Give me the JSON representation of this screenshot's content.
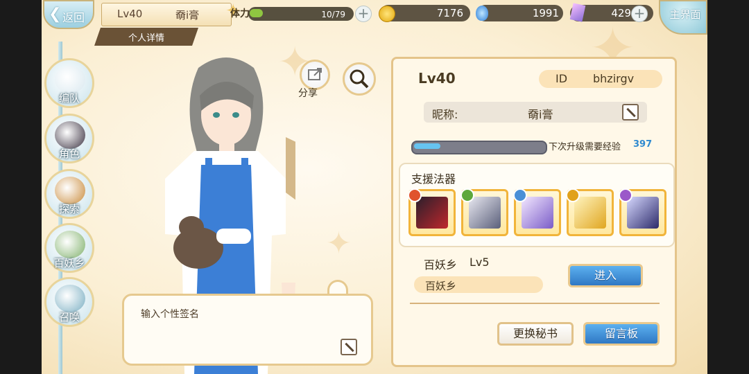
{
  "top_bar": {
    "back_label": "返回",
    "player_level": "Lv40",
    "player_name": "奣i膏",
    "subtab_label": "个人详情",
    "stamina_label": "体力",
    "stamina_text": "10/79",
    "stamina_fraction": 0.13,
    "coins": "7176",
    "spirit": "1991",
    "crystals": "429",
    "home_label": "主界面"
  },
  "side_menu": {
    "items": [
      {
        "label": "编队",
        "icon": "team-icon"
      },
      {
        "label": "角色",
        "icon": "character-icon"
      },
      {
        "label": "探索",
        "icon": "explore-icon"
      },
      {
        "label": "百妖乡",
        "icon": "village-icon"
      },
      {
        "label": "召唤",
        "icon": "summon-icon"
      }
    ]
  },
  "actions": {
    "share_label": "分享"
  },
  "signature": {
    "placeholder": "输入个性签名"
  },
  "profile": {
    "level": "Lv40",
    "id_label": "ID",
    "id_value": "bhzirgv",
    "nickname_label": "昵称:",
    "nickname_value": "奣i膏",
    "xp_label": "下次升级需要经验",
    "xp_value": "397",
    "xp_fraction": 0.2,
    "support_title": "支援法器",
    "weapons": [
      {
        "icon": "red-fan-weapon-icon",
        "element_color": "#e0532d"
      },
      {
        "icon": "crossbow-weapon-icon",
        "element_color": "#5ea83c"
      },
      {
        "icon": "purple-sword-weapon-icon",
        "element_color": "#4a8fd6"
      },
      {
        "icon": "golden-blade-weapon-icon",
        "element_color": "#e1a21b"
      },
      {
        "icon": "dark-sword-weapon-icon",
        "element_color": "#9b59c9"
      }
    ],
    "village_name": "百妖乡",
    "village_level": "Lv5",
    "village_pill": "百妖乡",
    "enter_button": "进入",
    "secretary_button": "更换秘书",
    "message_button": "留言板"
  },
  "colors": {
    "accent_blue": "#3a88d4",
    "frame_gold": "#e4c48a",
    "panel_bg": "#fff8e8"
  }
}
